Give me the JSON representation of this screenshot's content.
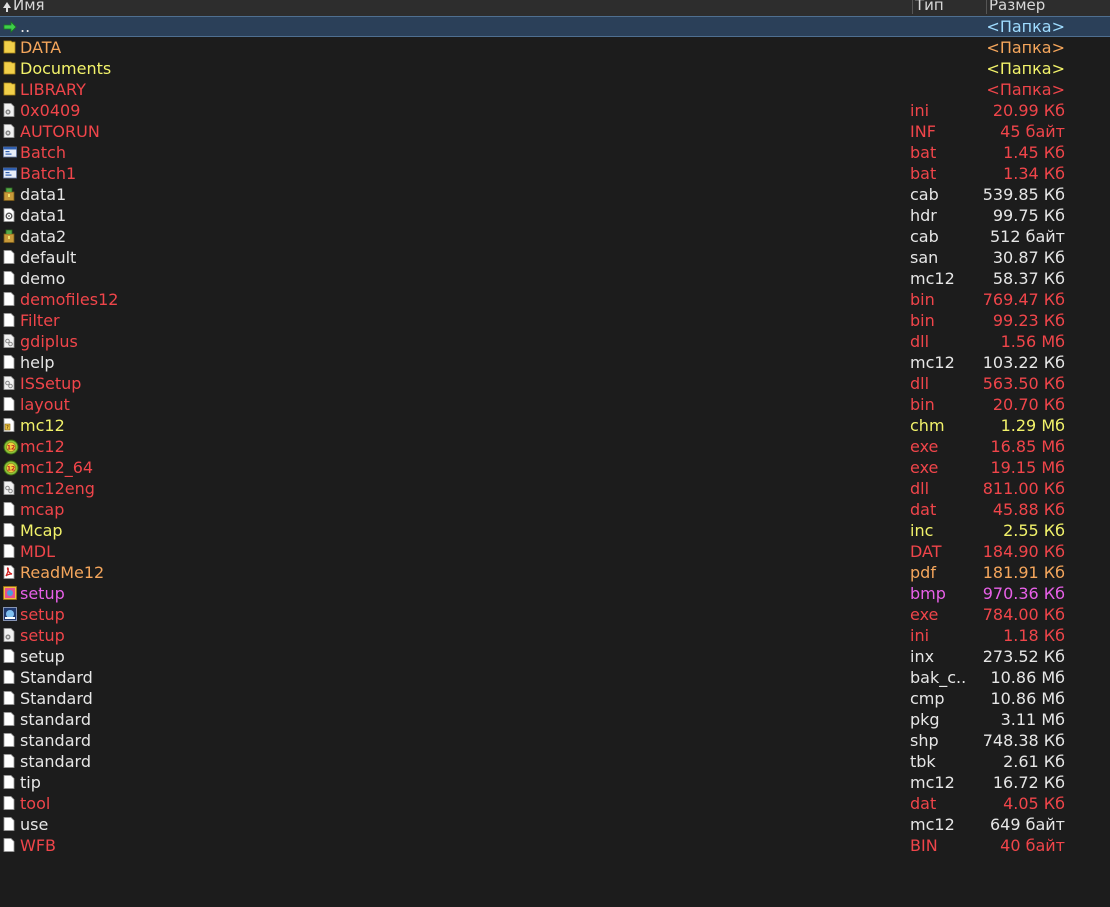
{
  "header": {
    "name_label": "Имя",
    "type_label": "Тип",
    "size_label": "Размер"
  },
  "colors": {
    "background": "#1c1c1c",
    "selection": "#2b4059",
    "white": "#e6e6e6",
    "red": "#f0454a",
    "yellow": "#f2f26a",
    "orange": "#f5a65c",
    "magenta": "#e860e8",
    "cyan": "#9fdcff"
  },
  "rows": [
    {
      "name": "..",
      "type": "",
      "size": "<Папка>",
      "icon": "up-arrow-icon",
      "color": "white",
      "size_color": "cyan",
      "selected": true
    },
    {
      "name": "DATA",
      "type": "",
      "size": "<Папка>",
      "icon": "folder-icon",
      "color": "orange",
      "size_color": "orange"
    },
    {
      "name": "Documents",
      "type": "",
      "size": "<Папка>",
      "icon": "folder-icon",
      "color": "yellow",
      "size_color": "yellow"
    },
    {
      "name": "LIBRARY",
      "type": "",
      "size": "<Папка>",
      "icon": "folder-icon",
      "color": "red",
      "size_color": "red"
    },
    {
      "name": "0x0409",
      "type": "ini",
      "size": "20.99 Кб",
      "icon": "settings-file-icon",
      "color": "red",
      "size_color": "red"
    },
    {
      "name": "AUTORUN",
      "type": "INF",
      "size": "45 байт",
      "icon": "settings-file-icon",
      "color": "red",
      "size_color": "red"
    },
    {
      "name": "Batch",
      "type": "bat",
      "size": "1.45 Кб",
      "icon": "batch-file-icon",
      "color": "red",
      "size_color": "red"
    },
    {
      "name": "Batch1",
      "type": "bat",
      "size": "1.34 Кб",
      "icon": "batch-file-icon",
      "color": "red",
      "size_color": "red"
    },
    {
      "name": "data1",
      "type": "cab",
      "size": "539.85 Кб",
      "icon": "archive-icon",
      "color": "white",
      "size_color": "white"
    },
    {
      "name": "data1",
      "type": "hdr",
      "size": "99.75 Кб",
      "icon": "gear-file-icon",
      "color": "white",
      "size_color": "white"
    },
    {
      "name": "data2",
      "type": "cab",
      "size": "512 байт",
      "icon": "archive-icon",
      "color": "white",
      "size_color": "white"
    },
    {
      "name": "default",
      "type": "san",
      "size": "30.87 Кб",
      "icon": "file-icon",
      "color": "white",
      "size_color": "white"
    },
    {
      "name": "demo",
      "type": "mc12",
      "size": "58.37 Кб",
      "icon": "file-icon",
      "color": "white",
      "size_color": "white"
    },
    {
      "name": "demofiles12",
      "type": "bin",
      "size": "769.47 Кб",
      "icon": "file-icon",
      "color": "red",
      "size_color": "red"
    },
    {
      "name": "Filter",
      "type": "bin",
      "size": "99.23 Кб",
      "icon": "file-icon",
      "color": "red",
      "size_color": "red"
    },
    {
      "name": "gdiplus",
      "type": "dll",
      "size": "1.56 Мб",
      "icon": "dll-file-icon",
      "color": "red",
      "size_color": "red"
    },
    {
      "name": "help",
      "type": "mc12",
      "size": "103.22 Кб",
      "icon": "file-icon",
      "color": "white",
      "size_color": "white"
    },
    {
      "name": "ISSetup",
      "type": "dll",
      "size": "563.50 Кб",
      "icon": "dll-file-icon",
      "color": "red",
      "size_color": "red"
    },
    {
      "name": "layout",
      "type": "bin",
      "size": "20.70 Кб",
      "icon": "file-icon",
      "color": "red",
      "size_color": "red"
    },
    {
      "name": "mc12",
      "type": "chm",
      "size": "1.29 Мб",
      "icon": "help-file-icon",
      "color": "yellow",
      "size_color": "yellow"
    },
    {
      "name": "mc12",
      "type": "exe",
      "size": "16.85 Мб",
      "icon": "app-icon",
      "color": "red",
      "size_color": "red"
    },
    {
      "name": "mc12_64",
      "type": "exe",
      "size": "19.15 Мб",
      "icon": "app-icon",
      "color": "red",
      "size_color": "red"
    },
    {
      "name": "mc12eng",
      "type": "dll",
      "size": "811.00 Кб",
      "icon": "dll-file-icon",
      "color": "red",
      "size_color": "red"
    },
    {
      "name": "mcap",
      "type": "dat",
      "size": "45.88 Кб",
      "icon": "file-icon",
      "color": "red",
      "size_color": "red"
    },
    {
      "name": "Mcap",
      "type": "inc",
      "size": "2.55 Кб",
      "icon": "file-icon",
      "color": "yellow",
      "size_color": "yellow"
    },
    {
      "name": "MDL",
      "type": "DAT",
      "size": "184.90 Кб",
      "icon": "file-icon",
      "color": "red",
      "size_color": "red"
    },
    {
      "name": "ReadMe12",
      "type": "pdf",
      "size": "181.91 Кб",
      "icon": "pdf-icon",
      "color": "orange",
      "size_color": "orange"
    },
    {
      "name": "setup",
      "type": "bmp",
      "size": "970.36 Кб",
      "icon": "image-icon",
      "color": "magenta",
      "size_color": "magenta"
    },
    {
      "name": "setup",
      "type": "exe",
      "size": "784.00 Кб",
      "icon": "setup-exe-icon",
      "color": "red",
      "size_color": "red"
    },
    {
      "name": "setup",
      "type": "ini",
      "size": "1.18 Кб",
      "icon": "settings-file-icon",
      "color": "red",
      "size_color": "red"
    },
    {
      "name": "setup",
      "type": "inx",
      "size": "273.52 Кб",
      "icon": "file-icon",
      "color": "white",
      "size_color": "white"
    },
    {
      "name": "Standard",
      "type": "bak_c..",
      "size": "10.86 Мб",
      "icon": "file-icon",
      "color": "white",
      "size_color": "white"
    },
    {
      "name": "Standard",
      "type": "cmp",
      "size": "10.86 Мб",
      "icon": "file-icon",
      "color": "white",
      "size_color": "white"
    },
    {
      "name": "standard",
      "type": "pkg",
      "size": "3.11 Мб",
      "icon": "file-icon",
      "color": "white",
      "size_color": "white"
    },
    {
      "name": "standard",
      "type": "shp",
      "size": "748.38 Кб",
      "icon": "file-icon",
      "color": "white",
      "size_color": "white"
    },
    {
      "name": "standard",
      "type": "tbk",
      "size": "2.61 Кб",
      "icon": "file-icon",
      "color": "white",
      "size_color": "white"
    },
    {
      "name": "tip",
      "type": "mc12",
      "size": "16.72 Кб",
      "icon": "file-icon",
      "color": "white",
      "size_color": "white"
    },
    {
      "name": "tool",
      "type": "dat",
      "size": "4.05 Кб",
      "icon": "file-icon",
      "color": "red",
      "size_color": "red"
    },
    {
      "name": "use",
      "type": "mc12",
      "size": "649 байт",
      "icon": "file-icon",
      "color": "white",
      "size_color": "white"
    },
    {
      "name": "WFB",
      "type": "BIN",
      "size": "40 байт",
      "icon": "file-icon",
      "color": "red",
      "size_color": "red"
    }
  ]
}
